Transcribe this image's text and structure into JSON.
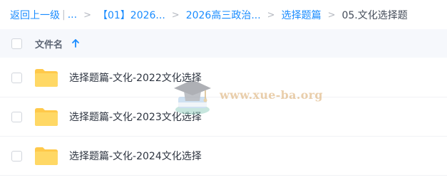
{
  "breadcrumb": {
    "back": "返回上一级",
    "ellipsis": "...",
    "items": [
      "【01】2026...",
      "2026高三政治...",
      "选择题篇"
    ],
    "current": "05.文化选择题",
    "separator": ">"
  },
  "table": {
    "header_name": "文件名",
    "sort": "ascending"
  },
  "files": [
    {
      "name": "选择题篇-文化-2022文化选择",
      "icon": "folder-icon"
    },
    {
      "name": "选择题篇-文化-2023文化选择",
      "icon": "folder-icon"
    },
    {
      "name": "选择题篇-文化-2024文化选择",
      "icon": "folder-icon"
    }
  ],
  "watermark": {
    "text": "www.xue-ba.org"
  },
  "colors": {
    "link": "#1a8cff",
    "folder": "#ffd255",
    "header_bg": "#f6f8fc"
  }
}
